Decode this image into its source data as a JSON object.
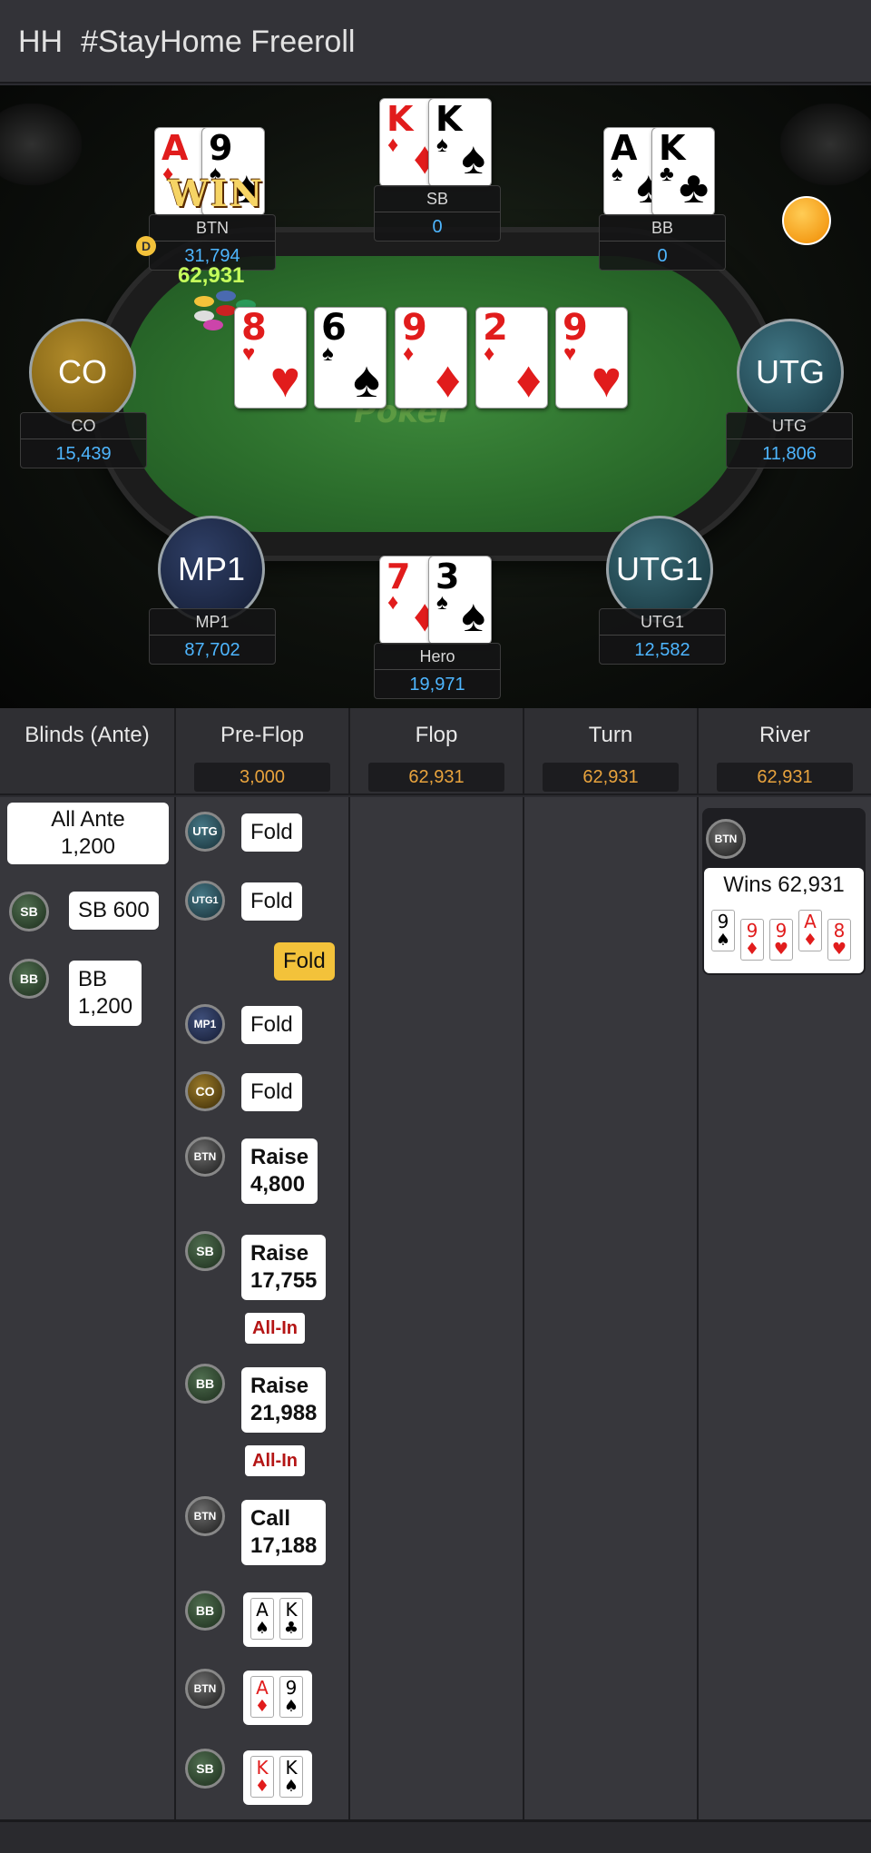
{
  "titlebar": {
    "hh": "HH",
    "title": "#StayHome Freeroll"
  },
  "table": {
    "logo_text": "Poker",
    "win_badge": "WIN",
    "dealer_glyph": "D",
    "pot": "62,931",
    "seats": {
      "btn": {
        "name": "BTN",
        "stack": "31,794",
        "cards": [
          {
            "rank": "A",
            "suit": "♦"
          },
          {
            "rank": "9",
            "suit": "♠"
          }
        ]
      },
      "sb": {
        "name": "SB",
        "stack": "0",
        "cards": [
          {
            "rank": "K",
            "suit": "♦"
          },
          {
            "rank": "K",
            "suit": "♠"
          }
        ]
      },
      "bb": {
        "name": "BB",
        "stack": "0",
        "cards": [
          {
            "rank": "A",
            "suit": "♠"
          },
          {
            "rank": "K",
            "suit": "♣"
          }
        ]
      },
      "co": {
        "circle": "CO",
        "name": "CO",
        "stack": "15,439"
      },
      "utg": {
        "circle": "UTG",
        "name": "UTG",
        "stack": "11,806"
      },
      "mp1": {
        "circle": "MP1",
        "name": "MP1",
        "stack": "87,702"
      },
      "utg1": {
        "circle": "UTG1",
        "name": "UTG1",
        "stack": "12,582"
      },
      "hero": {
        "name": "Hero",
        "stack": "19,971",
        "cards": [
          {
            "rank": "7",
            "suit": "♦"
          },
          {
            "rank": "3",
            "suit": "♠"
          }
        ]
      }
    },
    "board": [
      {
        "rank": "8",
        "suit": "♥"
      },
      {
        "rank": "6",
        "suit": "♠"
      },
      {
        "rank": "9",
        "suit": "♦"
      },
      {
        "rank": "2",
        "suit": "♦"
      },
      {
        "rank": "9",
        "suit": "♥"
      }
    ]
  },
  "columns": {
    "blinds": {
      "title": "Blinds (Ante)"
    },
    "preflop": {
      "title": "Pre-Flop",
      "pot": "3,000"
    },
    "flop": {
      "title": "Flop",
      "pot": "62,931"
    },
    "turn": {
      "title": "Turn",
      "pot": "62,931"
    },
    "river": {
      "title": "River",
      "pot": "62,931"
    }
  },
  "blinds_actions": {
    "ante": "All Ante\n1,200",
    "ante_line1": "All Ante",
    "ante_line2": "1,200",
    "sb_badge": "SB",
    "sb_text": "SB 600",
    "bb_badge": "BB",
    "bb_line1": "BB",
    "bb_line2": "1,200"
  },
  "preflop_actions": {
    "utg": {
      "badge": "UTG",
      "text": "Fold"
    },
    "utg1": {
      "badge": "UTG1",
      "text": "Fold"
    },
    "hero": {
      "text": "Fold"
    },
    "mp1": {
      "badge": "MP1",
      "text": "Fold"
    },
    "co": {
      "badge": "CO",
      "text": "Fold"
    },
    "btn_raise": {
      "badge": "BTN",
      "line1": "Raise",
      "line2": "4,800"
    },
    "sb_raise": {
      "badge": "SB",
      "line1": "Raise",
      "line2": "17,755",
      "allin": "All-In"
    },
    "bb_raise": {
      "badge": "BB",
      "line1": "Raise",
      "line2": "21,988",
      "allin": "All-In"
    },
    "btn_call": {
      "badge": "BTN",
      "line1": "Call",
      "line2": "17,188"
    },
    "bb_show": {
      "badge": "BB",
      "cards": [
        {
          "rank": "A",
          "suit": "♠"
        },
        {
          "rank": "K",
          "suit": "♣"
        }
      ]
    },
    "btn_show": {
      "badge": "BTN",
      "cards": [
        {
          "rank": "A",
          "suit": "♦"
        },
        {
          "rank": "9",
          "suit": "♠"
        }
      ]
    },
    "sb_show": {
      "badge": "SB",
      "cards": [
        {
          "rank": "K",
          "suit": "♦"
        },
        {
          "rank": "K",
          "suit": "♠"
        }
      ]
    }
  },
  "river_actions": {
    "badge": "BTN",
    "wins": "Wins 62,931",
    "cards": [
      {
        "rank": "9",
        "suit": "♠"
      },
      {
        "rank": "9",
        "suit": "♦"
      },
      {
        "rank": "9",
        "suit": "♥"
      },
      {
        "rank": "A",
        "suit": "♦"
      },
      {
        "rank": "8",
        "suit": "♥"
      }
    ]
  },
  "colors": {
    "stack_blue": "#4eb6ff",
    "pot_orange": "#e8a33d",
    "allin_red": "#b41515",
    "fold_yellow": "#f3c23a"
  }
}
